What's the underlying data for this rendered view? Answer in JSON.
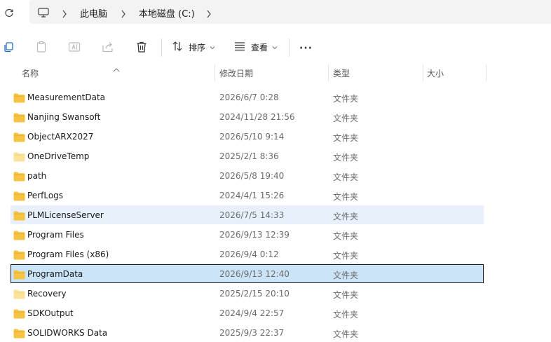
{
  "address": {
    "crumbs": [
      "此电脑",
      "本地磁盘 (C:)"
    ]
  },
  "toolbar": {
    "sort_label": "排序",
    "view_label": "查看",
    "more_label": "···"
  },
  "columns": {
    "name": "名称",
    "date": "修改日期",
    "type": "类型",
    "size": "大小"
  },
  "rows": [
    {
      "name": "MeasurementData",
      "date": "2026/6/7 0:28",
      "type": "文件夹"
    },
    {
      "name": "Nanjing Swansoft",
      "date": "2024/11/28 21:56",
      "type": "文件夹"
    },
    {
      "name": "ObjectARX2027",
      "date": "2026/5/10 9:14",
      "type": "文件夹"
    },
    {
      "name": "OneDriveTemp",
      "date": "2025/2/1 8:36",
      "type": "文件夹"
    },
    {
      "name": "path",
      "date": "2026/5/8 19:40",
      "type": "文件夹"
    },
    {
      "name": "PerfLogs",
      "date": "2024/4/1 15:26",
      "type": "文件夹"
    },
    {
      "name": "PLMLicenseServer",
      "date": "2026/7/5 14:33",
      "type": "文件夹"
    },
    {
      "name": "Program Files",
      "date": "2026/9/13 12:39",
      "type": "文件夹"
    },
    {
      "name": "Program Files (x86)",
      "date": "2026/9/4 0:12",
      "type": "文件夹"
    },
    {
      "name": "ProgramData",
      "date": "2026/9/13 12:40",
      "type": "文件夹"
    },
    {
      "name": "Recovery",
      "date": "2025/2/15 20:10",
      "type": "文件夹"
    },
    {
      "name": "SDKOutput",
      "date": "2024/9/4 22:57",
      "type": "文件夹"
    },
    {
      "name": "SOLIDWORKS Data",
      "date": "2025/9/3 22:37",
      "type": "文件夹"
    }
  ],
  "colors": {
    "folder": "#f6c342",
    "folder_light": "#fbe39a",
    "hover": "#e8f1fb",
    "selected": "#cce4f7"
  }
}
